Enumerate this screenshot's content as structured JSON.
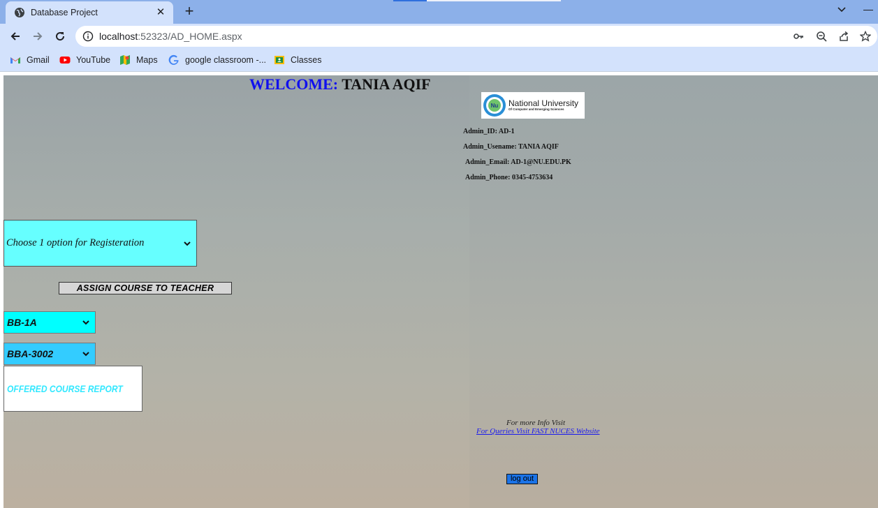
{
  "browser": {
    "tab_title": "Database Project",
    "url_host": "localhost",
    "url_path": ":52323/AD_HOME.aspx",
    "bookmarks": [
      {
        "label": "Gmail",
        "icon": "gmail-icon"
      },
      {
        "label": "YouTube",
        "icon": "youtube-icon"
      },
      {
        "label": "Maps",
        "icon": "maps-icon"
      },
      {
        "label": "google classroom -...",
        "icon": "google-icon"
      },
      {
        "label": "Classes",
        "icon": "classroom-icon"
      }
    ]
  },
  "page": {
    "welcome_label": "WELCOME:",
    "welcome_name": "TANIA AQIF",
    "logo": {
      "title": "National University",
      "subtitle": "Of Computer and Emerging Sciences"
    },
    "admin": {
      "id": "Admin_ID: AD-1",
      "username": "Admin_Usename: TANIA AQIF",
      "email": "Admin_Email: AD-1@NU.EDU.PK",
      "phone": "Admin_Phone: 0345-4753634"
    },
    "registration_select": "Choose 1 option for Registeration",
    "assign_button": "ASSIGN COURSE TO TEACHER",
    "section_select": "BB-1A",
    "course_select": "BBA-3002",
    "report_select": "OFFERED COURSE REPORT",
    "more_info": "For more Info Visit",
    "query_link": "For Queries Visit FAST NUCES Website",
    "logout_button": "log out"
  },
  "colors": {
    "welcome": "#1010ee",
    "registration_select_bg": "#66ffff",
    "section_select_bg": "#00ffff",
    "course_select_bg": "#33ccff",
    "report_text": "#33e8ff",
    "logout_bg": "#1a73e8",
    "link": "#1a1aee"
  }
}
